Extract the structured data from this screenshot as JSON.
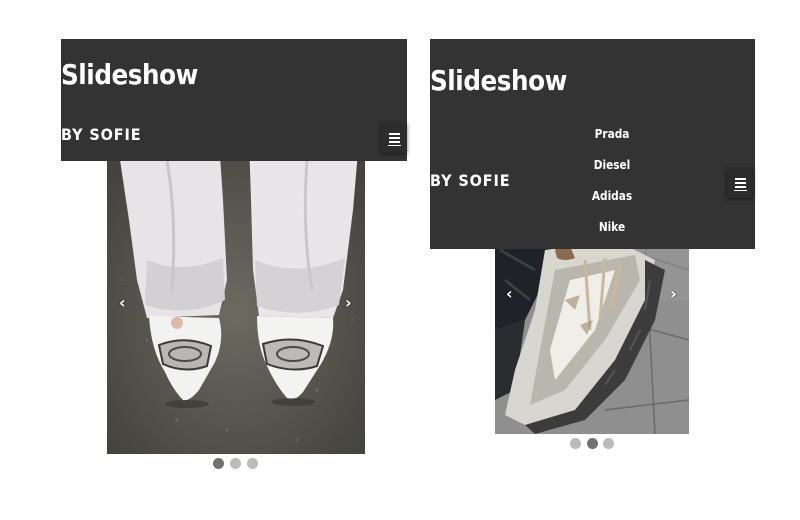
{
  "left_panel": {
    "title": "Slideshow",
    "subtitle": "BY SOFIE",
    "menu_icon": "hamburger-menu-icon",
    "prev_arrow": "‹",
    "next_arrow": "›",
    "slide_image": "white pointed shoes with silver buckle, white jeans",
    "dots": {
      "count": 3,
      "active_index": 0
    }
  },
  "right_panel": {
    "title": "Slideshow",
    "subtitle": "BY SOFIE",
    "menu_icon": "hamburger-menu-icon",
    "nav_items": [
      "Prada",
      "Diesel",
      "Adidas",
      "Nike"
    ],
    "prev_arrow": "‹",
    "next_arrow": "›",
    "slide_image": "silver metallic sneaker on tiled floor",
    "dots": {
      "count": 3,
      "active_index": 1
    }
  },
  "colors": {
    "header_bg": "#333333",
    "text": "#ffffff",
    "dot_inactive": "#bbbbbb",
    "dot_active": "#717171"
  }
}
